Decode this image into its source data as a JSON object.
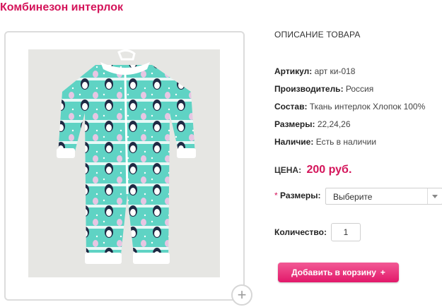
{
  "product": {
    "title": "Комбинезон интерлок",
    "image_alt_icon": "baby-jumpsuit-photo",
    "zoom_icon_symbol": "+"
  },
  "details": {
    "section_heading": "ОПИСАНИЕ ТОВАРА",
    "specs": [
      {
        "label": "Артикул:",
        "value": "арт ки-018"
      },
      {
        "label": "Производитель:",
        "value": "Россия"
      },
      {
        "label": "Состав:",
        "value": "Ткань интерлок Хлопок 100%"
      },
      {
        "label": "Размеры:",
        "value": "22,24,26"
      },
      {
        "label": "Наличие:",
        "value": "Есть в наличии"
      }
    ]
  },
  "price": {
    "label": "ЦЕНА:",
    "value": "200 руб."
  },
  "options": {
    "required_mark": "*",
    "size_label": "Размеры:",
    "size_selected": "Выберите"
  },
  "quantity": {
    "label": "Количество:",
    "value": "1"
  },
  "cart": {
    "button_label": "Добавить в корзину",
    "plus_symbol": "+"
  },
  "colors": {
    "accent": "#d4145a",
    "button": "#e2186a",
    "fabric": "#5fd3c4"
  }
}
